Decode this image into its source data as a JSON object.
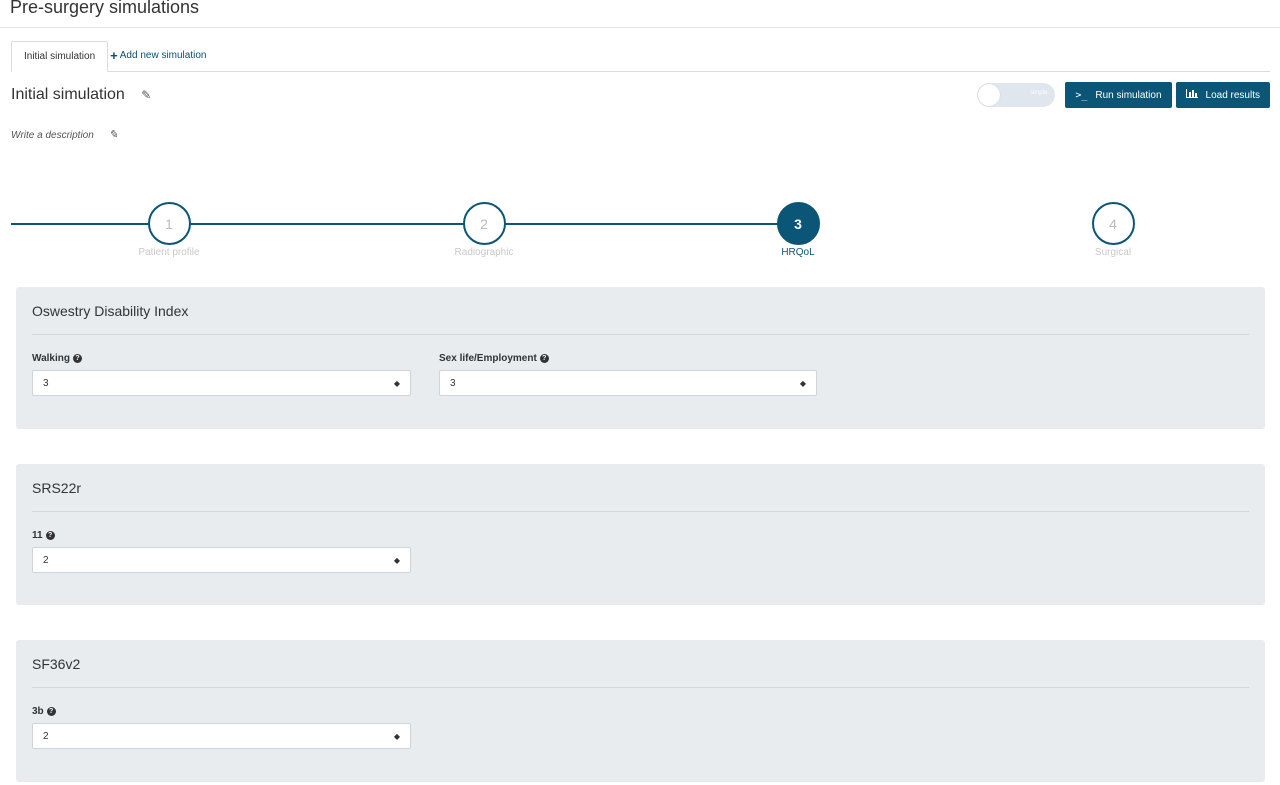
{
  "page": {
    "title": "Pre-surgery simulations"
  },
  "tabs": {
    "active_label": "Initial simulation",
    "add_label": "Add new simulation"
  },
  "simulation": {
    "title": "Initial simulation",
    "description_placeholder": "Write a description",
    "toggle_label": "simple",
    "run_label": "Run simulation",
    "load_label": "Load results"
  },
  "steps": [
    {
      "number": "1",
      "label": "Patient profile"
    },
    {
      "number": "2",
      "label": "Radiographic"
    },
    {
      "number": "3",
      "label": "HRQoL"
    },
    {
      "number": "4",
      "label": "Surgical"
    }
  ],
  "active_step": 3,
  "panels": {
    "odi": {
      "title": "Oswestry Disability Index",
      "fields": [
        {
          "label": "Walking",
          "value": "3"
        },
        {
          "label": "Sex life/Employment",
          "value": "3"
        }
      ]
    },
    "srs": {
      "title": "SRS22r",
      "fields": [
        {
          "label": "11",
          "value": "2"
        }
      ]
    },
    "sf36": {
      "title": "SF36v2",
      "fields": [
        {
          "label": "3b",
          "value": "2"
        }
      ]
    }
  },
  "colors": {
    "primary": "#0b5576",
    "panel_bg": "#e8ecef"
  },
  "icons": {
    "edit": "pencil-icon",
    "help": "question-circle-icon",
    "terminal": "terminal-icon",
    "chart": "bar-chart-icon",
    "select_caret": "sort-caret-icon"
  }
}
